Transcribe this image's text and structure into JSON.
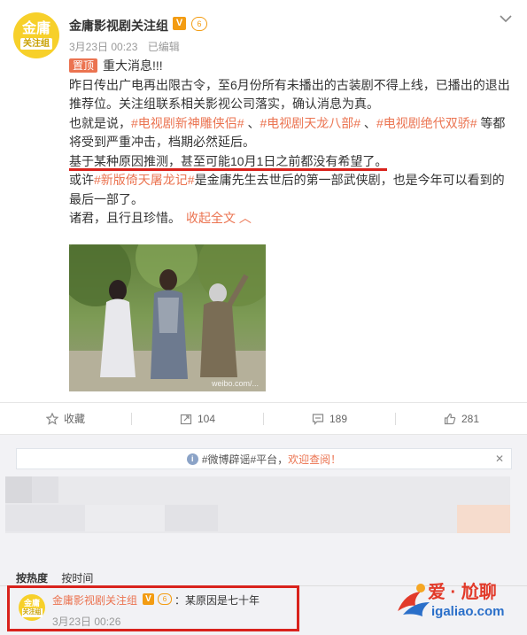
{
  "post": {
    "avatar_line1": "金庸",
    "avatar_line2": "关注组",
    "author": "金庸影视剧关注组",
    "v_badge": "V",
    "level_badge": "6",
    "date": "3月23日 00:23",
    "edited": "已编辑",
    "pin_label": "置顶",
    "headline": "重大消息!!!",
    "para1": "昨日传出广电再出限古令，至6月份所有未播出的古装剧不得上线，已播出的退出推荐位。关注组联系相关影视公司落实，确认消息为真。",
    "para2_a": "也就是说，",
    "tag1": "#电视剧新神雕侠侣#",
    "para2_b": " 、",
    "tag2": "#电视剧天龙八部#",
    "para2_c": " 、",
    "tag3": "#电视剧绝代双骄#",
    "para2_d": " 等都将受到严重冲击，档期必然延后。",
    "para3": "基于某种原因推测，甚至可能10月1日之前都没有希望了。",
    "para4_a": "或许",
    "tag4": "#新版倚天屠龙记#",
    "para4_b": "是金庸先生去世后的第一部武侠剧，也是今年可以看到的最后一部了。",
    "para5": "诸君，且行且珍惜。",
    "collapse": "收起全文 ︿",
    "photo_watermark": "weibo.com/..."
  },
  "actions": {
    "favorite": "收藏",
    "repost": "104",
    "comment": "189",
    "like": "281"
  },
  "comments": {
    "notice_prefix": "#微博辟谣#平台，",
    "notice_highlight": "欢迎查阅！",
    "notice_close": "✕",
    "sort_hot": "按热度",
    "sort_time": "按时间",
    "comment1": {
      "avatar_line1": "金庸",
      "avatar_line2": "关注组",
      "author": "金庸影视剧关注组",
      "v_badge": "V",
      "level_badge": "6",
      "text": "：某原因是七十年",
      "time": "3月23日 00:26"
    }
  },
  "watermark_logo": {
    "line1": "爱 · 尬聊",
    "line2": "igaliao.com"
  },
  "colors": {
    "accent": "#eb7350",
    "highlight_red": "#d9221c",
    "avatar_yellow": "#f7d02a"
  }
}
